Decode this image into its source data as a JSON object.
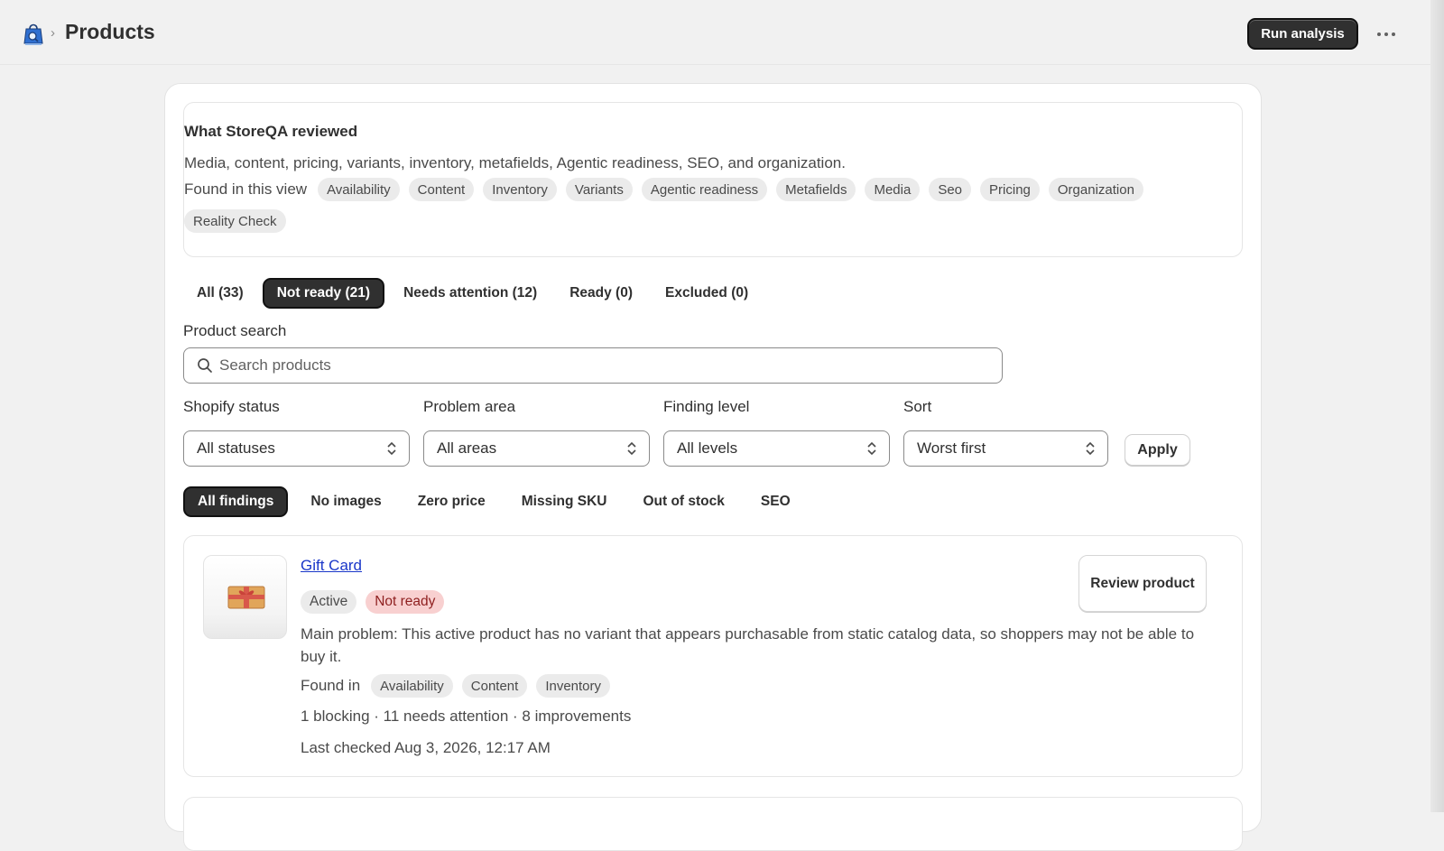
{
  "header": {
    "title": "Products",
    "run_button": "Run analysis",
    "app_icon": "storeqa-app-icon",
    "more_icon": "more-horizontal-icon"
  },
  "review": {
    "title": "What StoreQA reviewed",
    "description": "Media, content, pricing, variants, inventory, metafields, Agentic readiness, SEO, and organization.",
    "found_label": "Found in this view",
    "tags": [
      "Availability",
      "Content",
      "Inventory",
      "Variants",
      "Agentic readiness",
      "Metafields",
      "Media",
      "Seo",
      "Pricing",
      "Organization",
      "Reality Check"
    ]
  },
  "tabs": [
    {
      "label": "All (33)",
      "active": false
    },
    {
      "label": "Not ready (21)",
      "active": true
    },
    {
      "label": "Needs attention (12)",
      "active": false
    },
    {
      "label": "Ready (0)",
      "active": false
    },
    {
      "label": "Excluded (0)",
      "active": false
    }
  ],
  "search": {
    "label": "Product search",
    "placeholder": "Search products",
    "value": ""
  },
  "filters": {
    "status": {
      "label": "Shopify status",
      "value": "All statuses"
    },
    "area": {
      "label": "Problem area",
      "value": "All areas"
    },
    "level": {
      "label": "Finding level",
      "value": "All levels"
    },
    "sort": {
      "label": "Sort",
      "value": "Worst first"
    },
    "apply": "Apply"
  },
  "chips": [
    {
      "label": "All findings",
      "active": true
    },
    {
      "label": "No images",
      "active": false
    },
    {
      "label": "Zero price",
      "active": false
    },
    {
      "label": "Missing SKU",
      "active": false
    },
    {
      "label": "Out of stock",
      "active": false
    },
    {
      "label": "SEO",
      "active": false
    }
  ],
  "product": {
    "title": "Gift Card",
    "status_badge": "Active",
    "readiness_badge": "Not ready",
    "problem": "Main problem: This active product has no variant that appears purchasable from static catalog data, so shoppers may not be able to buy it.",
    "found_in_label": "Found in",
    "found_in_tags": [
      "Availability",
      "Content",
      "Inventory"
    ],
    "counts": "1 blocking · 11 needs attention · 8 improvements",
    "last_checked": "Last checked Aug 3, 2026, 12:17 AM",
    "review_button": "Review product",
    "thumbnail_icon": "gift-card-icon"
  },
  "colors": {
    "primary_button": "#303030",
    "link": "#1a37c9",
    "critical_badge_bg": "#f8d0d0",
    "critical_badge_text": "#8e1f1f",
    "neutral_pill_bg": "#ebebeb"
  }
}
